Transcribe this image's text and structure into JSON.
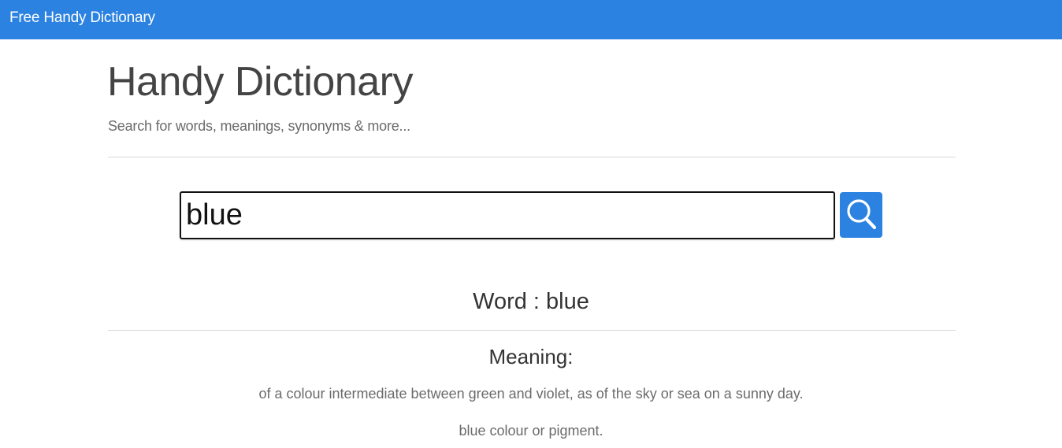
{
  "navbar": {
    "brand": "Free Handy Dictionary"
  },
  "header": {
    "title": "Handy Dictionary",
    "subtitle": "Search for words, meanings, synonyms & more..."
  },
  "search": {
    "value": "blue",
    "button_icon": "search-icon"
  },
  "result": {
    "word_heading": "Word : blue",
    "meaning_heading": "Meaning:",
    "meanings": [
      "of a colour intermediate between green and violet, as of the sky or sea on a sunny day.",
      "blue colour or pigment."
    ]
  },
  "colors": {
    "accent": "#2b82e0",
    "text": "#333333",
    "muted": "#6b6b6b"
  }
}
